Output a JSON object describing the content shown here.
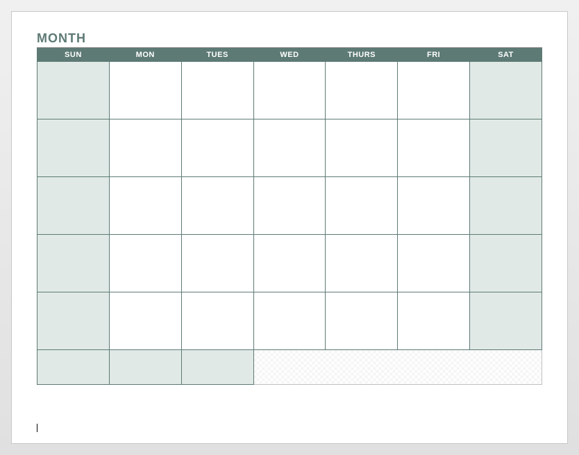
{
  "title": "MONTH",
  "days": {
    "sun": "SUN",
    "mon": "MON",
    "tues": "TUES",
    "wed": "WED",
    "thurs": "THURS",
    "fri": "FRI",
    "sat": "SAT"
  },
  "colors": {
    "header_bg": "#5d7a75",
    "header_text": "#ffffff",
    "weekend_bg": "#e0e9e5",
    "border": "#5d7a75"
  },
  "grid": {
    "rows": 6,
    "cols": 7,
    "last_row_weekend_span": 3,
    "last_row_notes_span": 4
  }
}
